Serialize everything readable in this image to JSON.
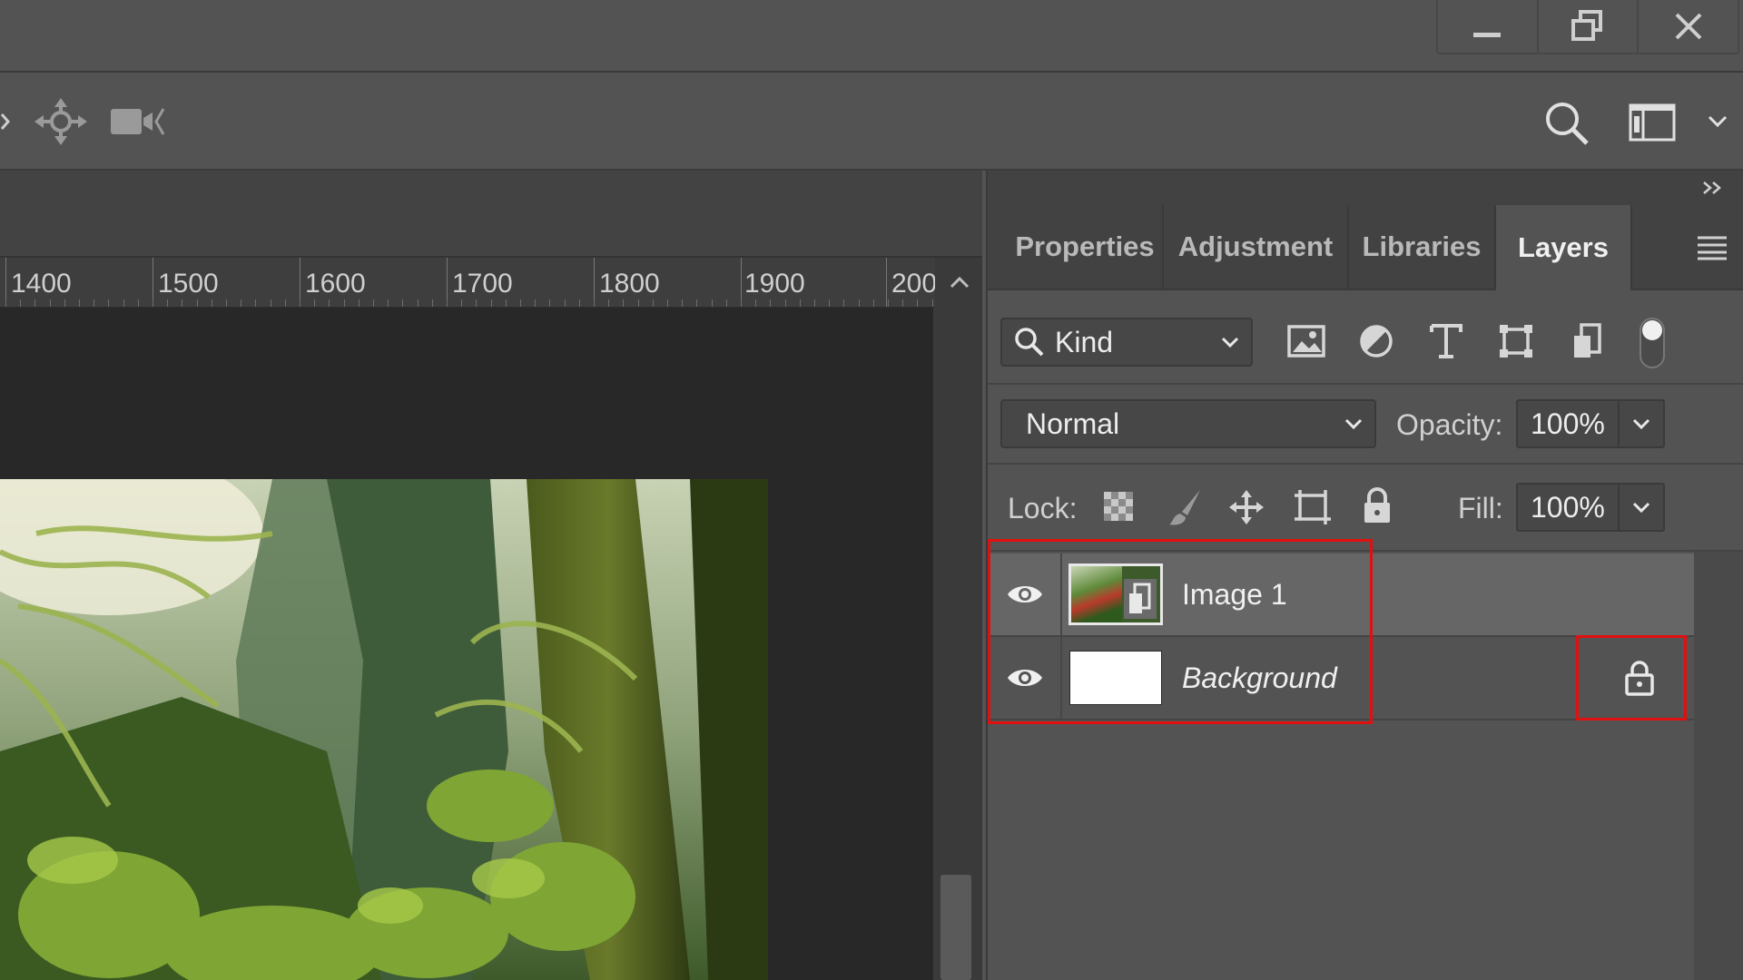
{
  "window": {
    "controls": {
      "minimize": "minimize-icon",
      "restore": "restore-icon",
      "close": "close-icon"
    }
  },
  "options_bar": {
    "icons": [
      "expand-arrow-icon",
      "3d-orbit-icon",
      "video-camera-icon",
      "search-icon",
      "workspace-icon",
      "chevron-down-icon"
    ]
  },
  "ruler": {
    "labels": [
      "1400",
      "1500",
      "1600",
      "1700",
      "1800",
      "1900",
      "200("
    ]
  },
  "panel": {
    "collapse_icon": "double-chevron-right-icon",
    "tabs": [
      {
        "label": "Properties",
        "active": false
      },
      {
        "label": "Adjustment",
        "active": false
      },
      {
        "label": "Libraries",
        "active": false
      },
      {
        "label": "Layers",
        "active": true
      }
    ],
    "menu_icon": "panel-menu-icon",
    "filter": {
      "kind_label": "Kind",
      "filter_icons": [
        "image-filter-icon",
        "adjustment-filter-icon",
        "type-filter-icon",
        "shape-filter-icon",
        "smart-object-filter-icon"
      ]
    },
    "blend": {
      "mode": "Normal",
      "opacity_label": "Opacity:",
      "opacity_value": "100%"
    },
    "lock": {
      "label": "Lock:",
      "fill_label": "Fill:",
      "fill_value": "100%"
    },
    "layers": [
      {
        "name": "Image 1",
        "selected": true,
        "visible": true,
        "locked": false
      },
      {
        "name": "Background",
        "selected": false,
        "visible": true,
        "locked": true
      }
    ]
  },
  "colors": {
    "highlight": "#e01010",
    "panel_bg": "#535353",
    "selected_row": "#666666"
  }
}
